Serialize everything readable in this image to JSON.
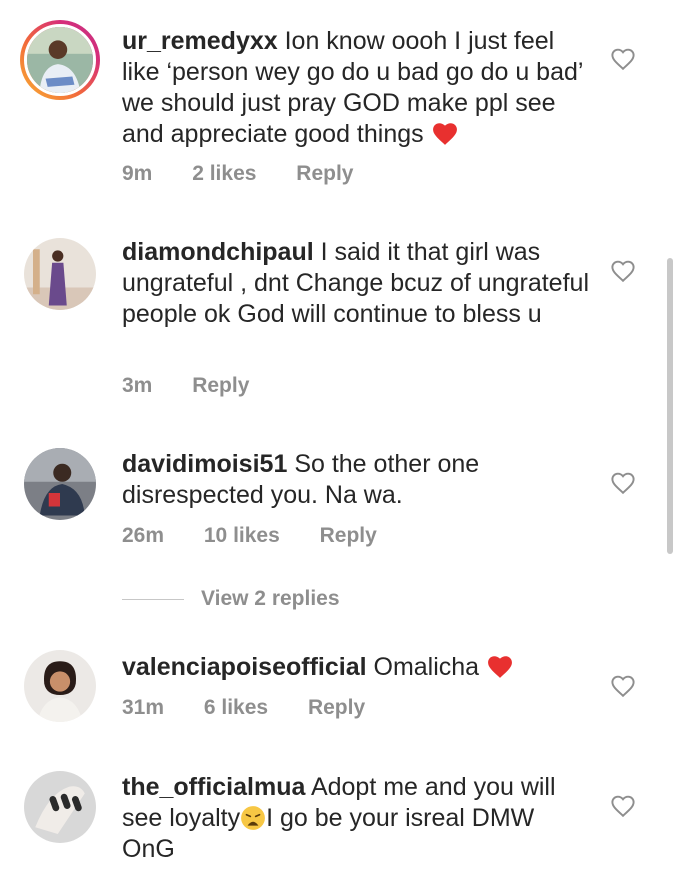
{
  "comments": [
    {
      "username": "ur_remedyxx",
      "text": "Ion know oooh I just feel like ‘person wey go do u bad go do u bad’ we should just pray GOD make ppl see and appreciate good things",
      "emoji": "heart",
      "time": "9m",
      "likes": "2 likes",
      "reply": "Reply",
      "has_story": true
    },
    {
      "username": "diamondchipaul",
      "text": "I said it that girl was ungrateful , dnt Change bcuz of ungrateful people ok God will continue to bless u",
      "time": "3m",
      "reply": "Reply"
    },
    {
      "username": "davidimoisi51",
      "text": "So the other one disrespected you. Na wa.",
      "time": "26m",
      "likes": "10 likes",
      "reply": "Reply"
    },
    {
      "username": "valenciapoiseofficial",
      "text": "Omalicha",
      "emoji": "heart",
      "time": "31m",
      "likes": "6 likes",
      "reply": "Reply"
    },
    {
      "username": "the_officialmua",
      "text_before": "Adopt me and you will see loyalty",
      "emoji": "weary-face",
      "text_after": "I go be your isreal DMW OnG"
    }
  ],
  "view_replies": "View 2 replies",
  "colors": {
    "text": "#262626",
    "meta": "#8e8e8e",
    "heart": "#e8302f",
    "story_gradient": [
      "#f9b233",
      "#d62d7a"
    ]
  },
  "icons": {
    "like": "heart-outline-icon",
    "heart_emoji": "red-heart-emoji",
    "weary_emoji": "weary-face-emoji"
  }
}
